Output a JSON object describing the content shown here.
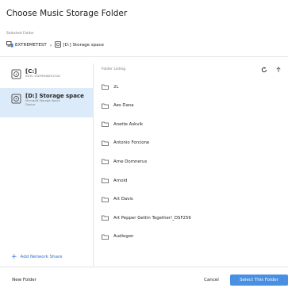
{
  "dialog": {
    "title": "Choose Music Storage Folder"
  },
  "selected": {
    "label": "Selected Folder",
    "crumbs": [
      "EXTREMETEST",
      "[D:] Storage space"
    ],
    "separator": "›"
  },
  "drives": [
    {
      "name": "[C:]",
      "sub": "INTEL SSDPEKNW512G8"
    },
    {
      "name": "[D:] Storage space",
      "sub1": "Microsoft Storage Space",
      "sub2": "Device"
    }
  ],
  "sidebar": {
    "add_share": "Add Network Share"
  },
  "listing": {
    "header": "Folder Listing",
    "folders": [
      "2L",
      "Aes Dana",
      "Anette Askvik",
      "Antonio Forcione",
      "Arne Domnerus",
      "Arnold",
      "Art Davis",
      "Art Pepper Gettin Together!_DSF256",
      "Audiogon"
    ]
  },
  "footer": {
    "new_folder": "New Folder",
    "cancel": "Cancel",
    "select": "Select This Folder"
  }
}
